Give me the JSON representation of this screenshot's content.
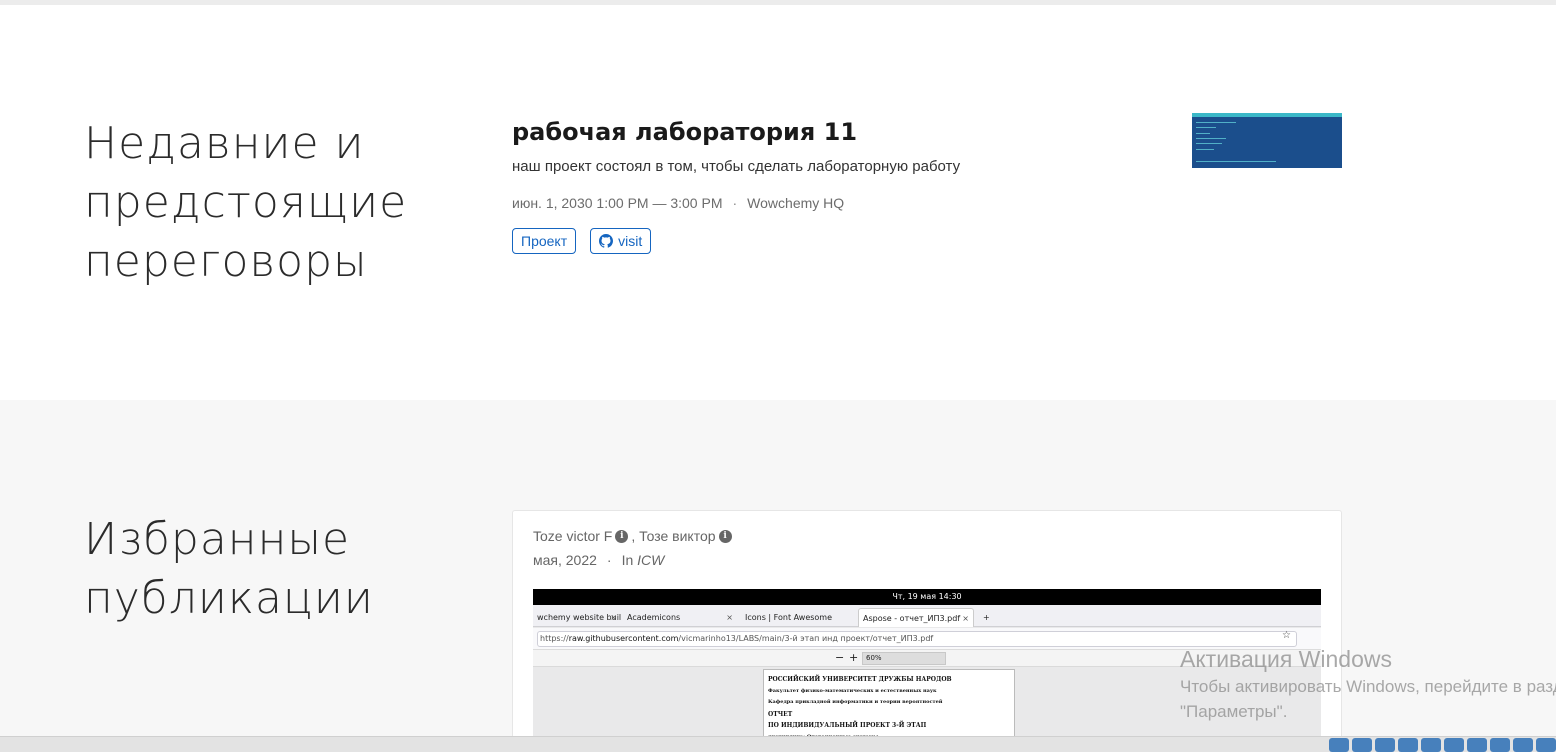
{
  "talks_section": {
    "heading": "Недавние и предстоящие переговоры",
    "item": {
      "title": "рабочая лаборатория 11",
      "summary": "наш проект состоял в том, чтобы сделать лабораторную работу",
      "datetime": "июн. 1, 2030 1:00 PM — 3:00 PM",
      "separator": "·",
      "location": "Wowchemy HQ",
      "buttons": {
        "project": "Проект",
        "visit": "visit"
      },
      "icons": {
        "visit": "github-icon"
      }
    }
  },
  "publications_section": {
    "heading": "Избранные публикации",
    "card": {
      "author_1": "Toze victor F",
      "author_2": ", Тозе виктор",
      "date": "мая, 2022",
      "separator": "·",
      "in_label": "In",
      "venue": "ICW",
      "icons": {
        "author_info": "info-icon"
      },
      "screenshot": {
        "clock": "Чт, 19 мая  14:30",
        "tabs": [
          "wchemy website buil",
          "Academicons",
          "Icons | Font Awesome",
          "Aspose - отчет_ИП3.pdf"
        ],
        "new_tab": "+",
        "close": "×",
        "url_prefix": "https://",
        "url_host": "raw.githubusercontent.com",
        "url_path": "/vicmarinho13/LABS/main/3-й этап инд проект/отчет_ИП3.pdf",
        "zoom_minus": "−",
        "zoom_plus": "+",
        "zoom": "60%",
        "pdf_lines": [
          "РОССИЙСКИЙ УНИВЕРСИТЕТ ДРУЖБЫ НАРОДОВ",
          "Факультет физико-математических и естественных наук",
          "Кафедра прикладной информатики и теории вероятностей",
          "ОТЧЕТ",
          "ПО ИНДИВИДУАЛЬНЫЙ ПРОЕКТ 3-Й ЭТАП",
          "дисциплина: Операционные системы"
        ]
      }
    }
  },
  "watermark": {
    "title": "Активация Windows",
    "subtitle": "Чтобы активировать Windows, перейдите в раздел",
    "subtitle2": "\"Параметры\"."
  },
  "colors": {
    "accent": "#1565c0",
    "section_alt_bg": "#f7f7f7",
    "thumb_bg": "#1b4e8c"
  }
}
